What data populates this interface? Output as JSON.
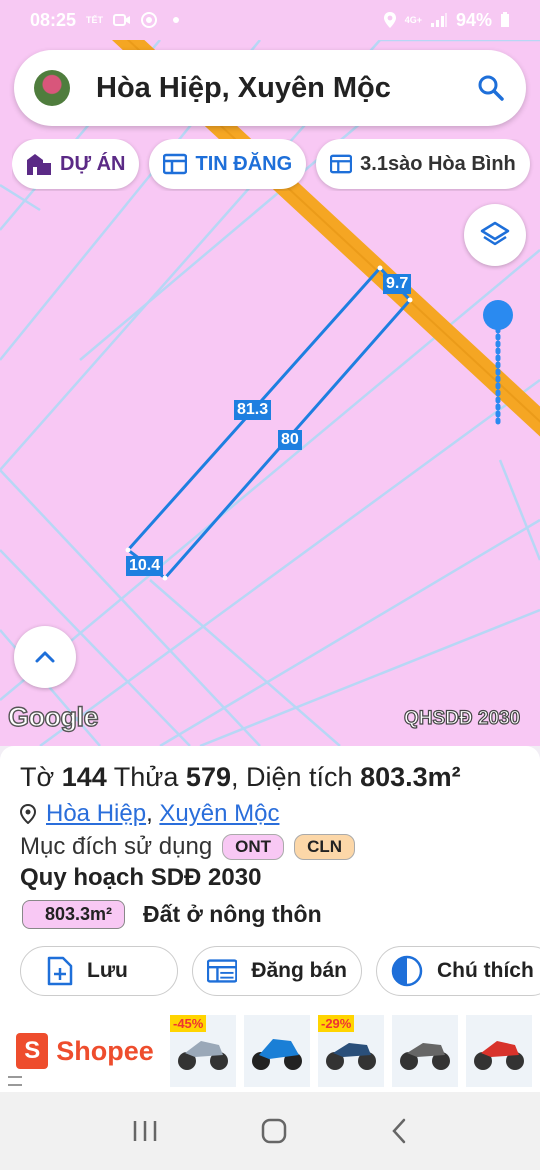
{
  "status_bar": {
    "time": "08:25",
    "tet_icon_text": "TẾT",
    "network": "4G+",
    "battery": "94%"
  },
  "search": {
    "title": "Hòa Hiệp, Xuyên Mộc"
  },
  "chips": [
    {
      "label": "DỰ ÁN"
    },
    {
      "label": "TIN ĐĂNG"
    },
    {
      "label": "3.1sào Hòa Bình"
    }
  ],
  "map": {
    "dimensions": {
      "top": "9.7",
      "long_side_1": "81.3",
      "long_side_2": "80",
      "bottom": "10.4"
    },
    "google": "Google",
    "layer_name": "QHSDĐ 2030"
  },
  "parcel": {
    "sheet_label": "Tờ",
    "sheet_number": "144",
    "lot_label": "Thửa",
    "lot_number": "579",
    "area_label": ", Diện tích",
    "area_value": "803.3m²",
    "location_commune": "Hòa Hiệp",
    "location_separator": ",",
    "location_district": "Xuyên Mộc",
    "purpose_label": "Mục đích sử dụng",
    "purpose_tags": [
      "ONT",
      "CLN"
    ],
    "plan_title": "Quy hoạch SDĐ 2030",
    "plan_area": "803.3m²",
    "plan_desc": "Đất ở nông thôn"
  },
  "actions": {
    "save": "Lưu",
    "post_sale": "Đăng bán",
    "legend": "Chú thích"
  },
  "ad": {
    "brand": "Shopee",
    "bag_letter": "S",
    "products": [
      {
        "discount": "-45%"
      },
      {
        "discount": ""
      },
      {
        "discount": "-29%"
      },
      {
        "discount": ""
      },
      {
        "discount": ""
      }
    ]
  },
  "colors": {
    "map_pink": "#f8c8f4",
    "road_orange": "#f5a623",
    "parcel_blue": "#1e7fe0",
    "brand_purple": "#5b2a86",
    "shopee_orange": "#ee4d2d"
  }
}
